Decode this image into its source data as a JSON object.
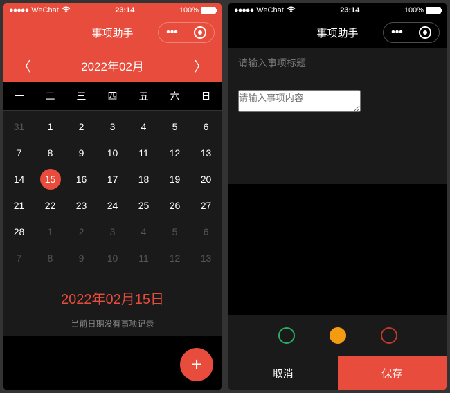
{
  "status": {
    "carrier": "WeChat",
    "time": "23:14",
    "battery_pct": "100%"
  },
  "nav": {
    "title": "事项助手",
    "menu_glyph": "•••"
  },
  "calendar": {
    "month_title": "2022年02月",
    "prev_glyph": "〈",
    "next_glyph": "〉",
    "weekdays": [
      "一",
      "二",
      "三",
      "四",
      "五",
      "六",
      "日"
    ],
    "days": [
      {
        "n": "31",
        "other": true
      },
      {
        "n": "1"
      },
      {
        "n": "2"
      },
      {
        "n": "3"
      },
      {
        "n": "4"
      },
      {
        "n": "5"
      },
      {
        "n": "6"
      },
      {
        "n": "7"
      },
      {
        "n": "8"
      },
      {
        "n": "9"
      },
      {
        "n": "10"
      },
      {
        "n": "11"
      },
      {
        "n": "12"
      },
      {
        "n": "13"
      },
      {
        "n": "14"
      },
      {
        "n": "15",
        "selected": true
      },
      {
        "n": "16"
      },
      {
        "n": "17"
      },
      {
        "n": "18"
      },
      {
        "n": "19"
      },
      {
        "n": "20"
      },
      {
        "n": "21"
      },
      {
        "n": "22"
      },
      {
        "n": "23"
      },
      {
        "n": "24"
      },
      {
        "n": "25"
      },
      {
        "n": "26"
      },
      {
        "n": "27"
      },
      {
        "n": "28"
      },
      {
        "n": "1",
        "other": true
      },
      {
        "n": "2",
        "other": true
      },
      {
        "n": "3",
        "other": true
      },
      {
        "n": "4",
        "other": true
      },
      {
        "n": "5",
        "other": true
      },
      {
        "n": "6",
        "other": true
      },
      {
        "n": "7",
        "other": true
      },
      {
        "n": "8",
        "other": true
      },
      {
        "n": "9",
        "other": true
      },
      {
        "n": "10",
        "other": true
      },
      {
        "n": "11",
        "other": true
      },
      {
        "n": "12",
        "other": true
      },
      {
        "n": "13",
        "other": true
      }
    ],
    "selected_date_label": "2022年02月15日",
    "empty_text": "当前日期没有事项记录",
    "fab_glyph": "+"
  },
  "form": {
    "title_placeholder": "请输入事项标题",
    "content_placeholder": "请输入事项内容",
    "colors": {
      "green": "#27ae60",
      "orange": "#f39c12",
      "red": "#c0392b",
      "selected": "orange"
    },
    "cancel_label": "取消",
    "save_label": "保存"
  }
}
